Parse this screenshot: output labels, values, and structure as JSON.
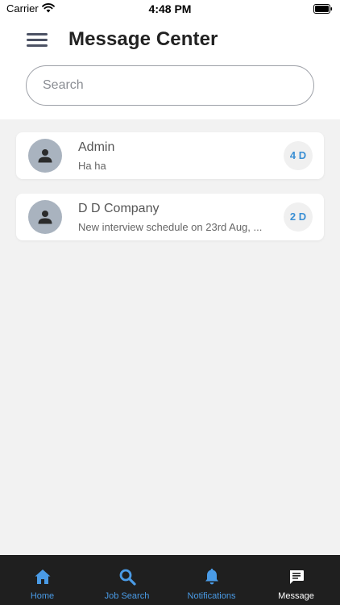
{
  "status_bar": {
    "carrier": "Carrier",
    "time": "4:48 PM"
  },
  "header": {
    "title": "Message Center"
  },
  "search": {
    "placeholder": "Search",
    "value": ""
  },
  "messages": [
    {
      "name": "Admin",
      "preview": "Ha ha",
      "age": "4 D"
    },
    {
      "name": "D D Company",
      "preview": "New interview schedule on 23rd Aug, ...",
      "age": "2 D"
    }
  ],
  "tabs": [
    {
      "label": "Home",
      "icon": "home-icon",
      "active": false
    },
    {
      "label": "Job Search",
      "icon": "search-icon",
      "active": false
    },
    {
      "label": "Notifications",
      "icon": "bell-icon",
      "active": false
    },
    {
      "label": "Message",
      "icon": "message-icon",
      "active": true
    }
  ],
  "colors": {
    "accent": "#4a9be6",
    "badge_text": "#3a8fd4",
    "tab_bar_bg": "#1f1f1f",
    "avatar_bg": "#a9b3bf"
  }
}
